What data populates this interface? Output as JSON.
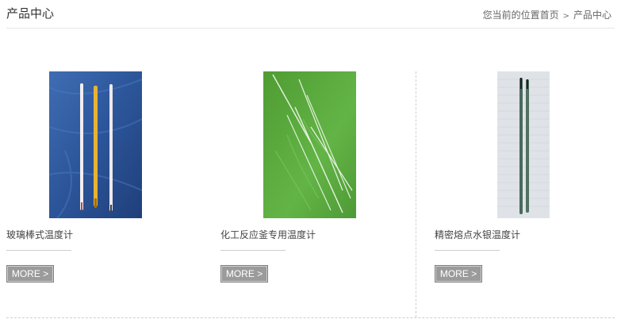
{
  "header": {
    "title": "产品中心",
    "breadcrumb": {
      "prefix": "您当前的位置",
      "home": "首页",
      "separator": ">",
      "current": "产品中心"
    }
  },
  "products": [
    {
      "name": "玻璃棒式温度计",
      "more_label": "MORE >"
    },
    {
      "name": "化工反应釜专用温度计",
      "more_label": "MORE >"
    },
    {
      "name": "精密熔点水银温度计",
      "more_label": "MORE >"
    }
  ],
  "colors": {
    "product1_bg": "#2f5aa1",
    "product2_bg": "#5aa63a",
    "product3_bg": "#dfe3e8",
    "more_button": "#9b9b9b"
  }
}
